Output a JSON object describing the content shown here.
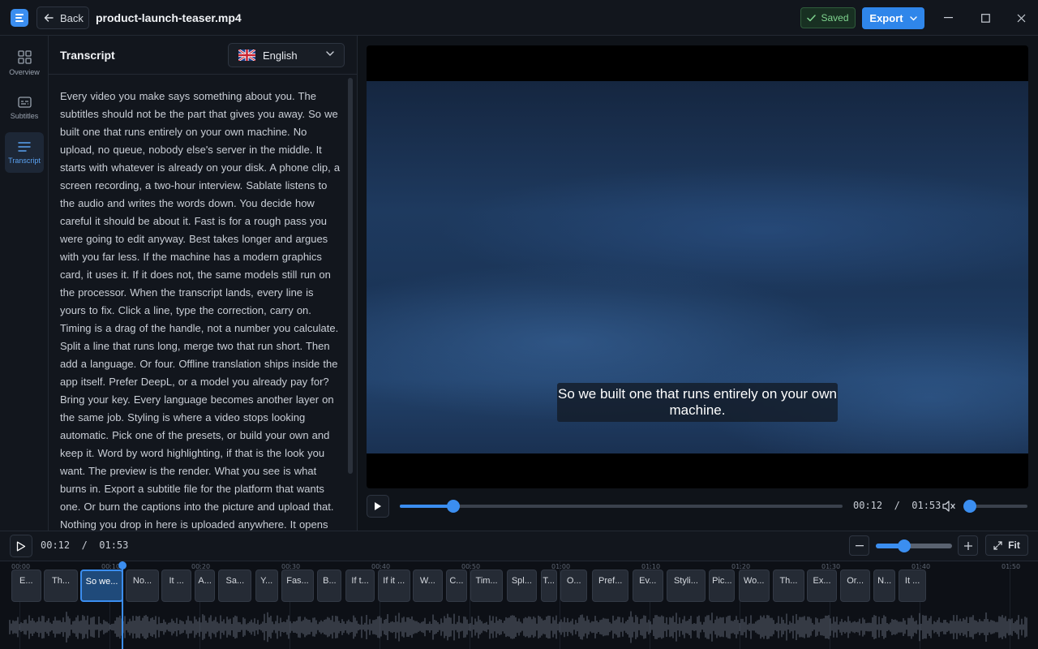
{
  "window": {
    "file_name": "product-launch-teaser.mp4",
    "back_label": "Back",
    "saved_label": "Saved",
    "export_label": "Export",
    "accent": "#3b8ef0"
  },
  "rail": {
    "items": [
      {
        "label": "Overview",
        "icon": "grid-icon"
      },
      {
        "label": "Subtitles",
        "icon": "subtitles-icon"
      },
      {
        "label": "Transcript",
        "icon": "lines-icon",
        "active": true
      }
    ]
  },
  "transcript": {
    "title": "Transcript",
    "language": "English",
    "text": "Every video you make says something about you.  The subtitles should not be the part that gives you away.  So we built one that runs entirely on your own machine.  No upload, no queue, nobody else's server in the middle.  It starts with whatever is already on your disk.  A phone clip, a screen recording, a two-hour interview.  Sablate listens to the audio and writes the words down.  You decide how careful it should be about it.  Fast is for a rough pass you were going to edit anyway.  Best takes longer and argues with you far less.  If the machine has a modern graphics card, it uses it.  If it does not, the same models still run on the processor.  When the transcript lands, every line is yours to fix.  Click a line, type the correction, carry on.  Timing is a drag of the handle, not a number you calculate.  Split a line that runs long, merge two that run short.  Then add a language. Or four.  Offline translation ships inside the app itself.  Prefer DeepL, or a model you already pay for? Bring your key.  Every language becomes another layer on the same job.  Styling is where a video stops looking automatic.  Pick one of the presets, or build your own and keep it.  Word by word highlighting, if that is the look you want.  The preview is the render. What you see is what burns in.  Export a subtitle file for the platform that wants one.  Or burn the captions into the picture and upload that.  Nothing you drop in here is uploaded anywhere.  It opens"
  },
  "player": {
    "subtitle": "So we built one that runs entirely on your own machine.",
    "current_time": "00:12",
    "duration": "01:53",
    "time_display": "00:12  /  01:53",
    "progress": 0.12,
    "volume": 0
  },
  "timeline": {
    "time_display": "00:12  /  01:53",
    "zoom_level": 0.37,
    "fit_label": "Fit",
    "ruler": [
      "00:00",
      "00:10",
      "00:20",
      "00:30",
      "00:40",
      "00:50",
      "01:00",
      "01:10",
      "01:20",
      "01:30",
      "01:40",
      "01:50"
    ],
    "clips": [
      {
        "label": "E...",
        "start": 0.0,
        "end": 3.3
      },
      {
        "label": "Th...",
        "start": 3.6,
        "end": 7.4
      },
      {
        "label": "So we...",
        "start": 7.7,
        "end": 12.4,
        "active": true
      },
      {
        "label": "No...",
        "start": 12.7,
        "end": 16.4
      },
      {
        "label": "It ...",
        "start": 16.7,
        "end": 20.0
      },
      {
        "label": "A...",
        "start": 20.4,
        "end": 22.6
      },
      {
        "label": "Sa...",
        "start": 23.0,
        "end": 26.7
      },
      {
        "label": "Y...",
        "start": 27.1,
        "end": 29.6
      },
      {
        "label": "Fas...",
        "start": 30.0,
        "end": 33.6
      },
      {
        "label": "B...",
        "start": 34.0,
        "end": 36.7
      },
      {
        "label": "If t...",
        "start": 37.1,
        "end": 40.4
      },
      {
        "label": "If it ...",
        "start": 40.7,
        "end": 44.3
      },
      {
        "label": "W...",
        "start": 44.6,
        "end": 47.9
      },
      {
        "label": "C...",
        "start": 48.3,
        "end": 50.6
      },
      {
        "label": "Tim...",
        "start": 51.0,
        "end": 54.6
      },
      {
        "label": "Spl...",
        "start": 55.0,
        "end": 58.4
      },
      {
        "label": "T...",
        "start": 58.8,
        "end": 60.6
      },
      {
        "label": "O...",
        "start": 61.0,
        "end": 64.0
      },
      {
        "label": "Pref...",
        "start": 64.5,
        "end": 68.6
      },
      {
        "label": "Ev...",
        "start": 69.0,
        "end": 72.4
      },
      {
        "label": "Styli...",
        "start": 72.8,
        "end": 77.1
      },
      {
        "label": "Pic...",
        "start": 77.5,
        "end": 80.4
      },
      {
        "label": "Wo...",
        "start": 80.8,
        "end": 84.2
      },
      {
        "label": "Th...",
        "start": 84.6,
        "end": 88.1
      },
      {
        "label": "Ex...",
        "start": 88.4,
        "end": 91.7
      },
      {
        "label": "Or...",
        "start": 92.1,
        "end": 95.4
      },
      {
        "label": "N...",
        "start": 95.8,
        "end": 98.2
      },
      {
        "label": "It ...",
        "start": 98.6,
        "end": 101.6
      }
    ]
  }
}
